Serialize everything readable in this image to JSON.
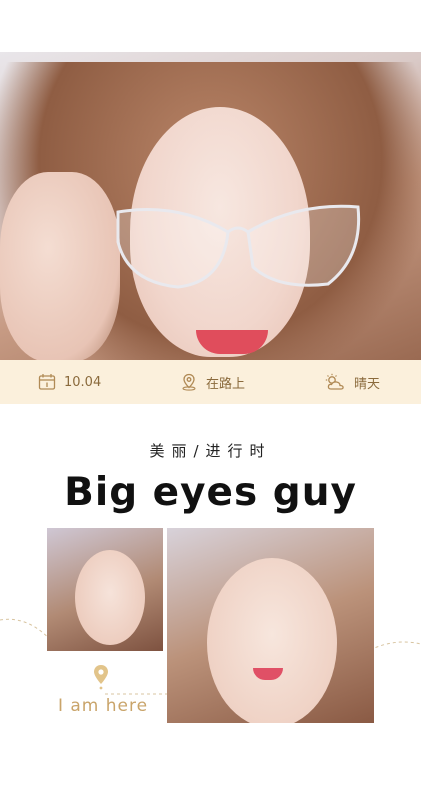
{
  "info": {
    "date": "10.04",
    "location": "在路上",
    "weather": "晴天"
  },
  "subtitle": "美丽/进行时",
  "title": "Big eyes guy",
  "tag": "I am here",
  "colors": {
    "info_bg": "#fbf0dc",
    "info_text": "#8a6a3c",
    "accent_gold": "#c9a46a"
  },
  "icons": {
    "date": "calendar-icon",
    "location": "map-pin-icon",
    "weather": "sun-cloud-icon",
    "tag": "location-pin-icon"
  }
}
